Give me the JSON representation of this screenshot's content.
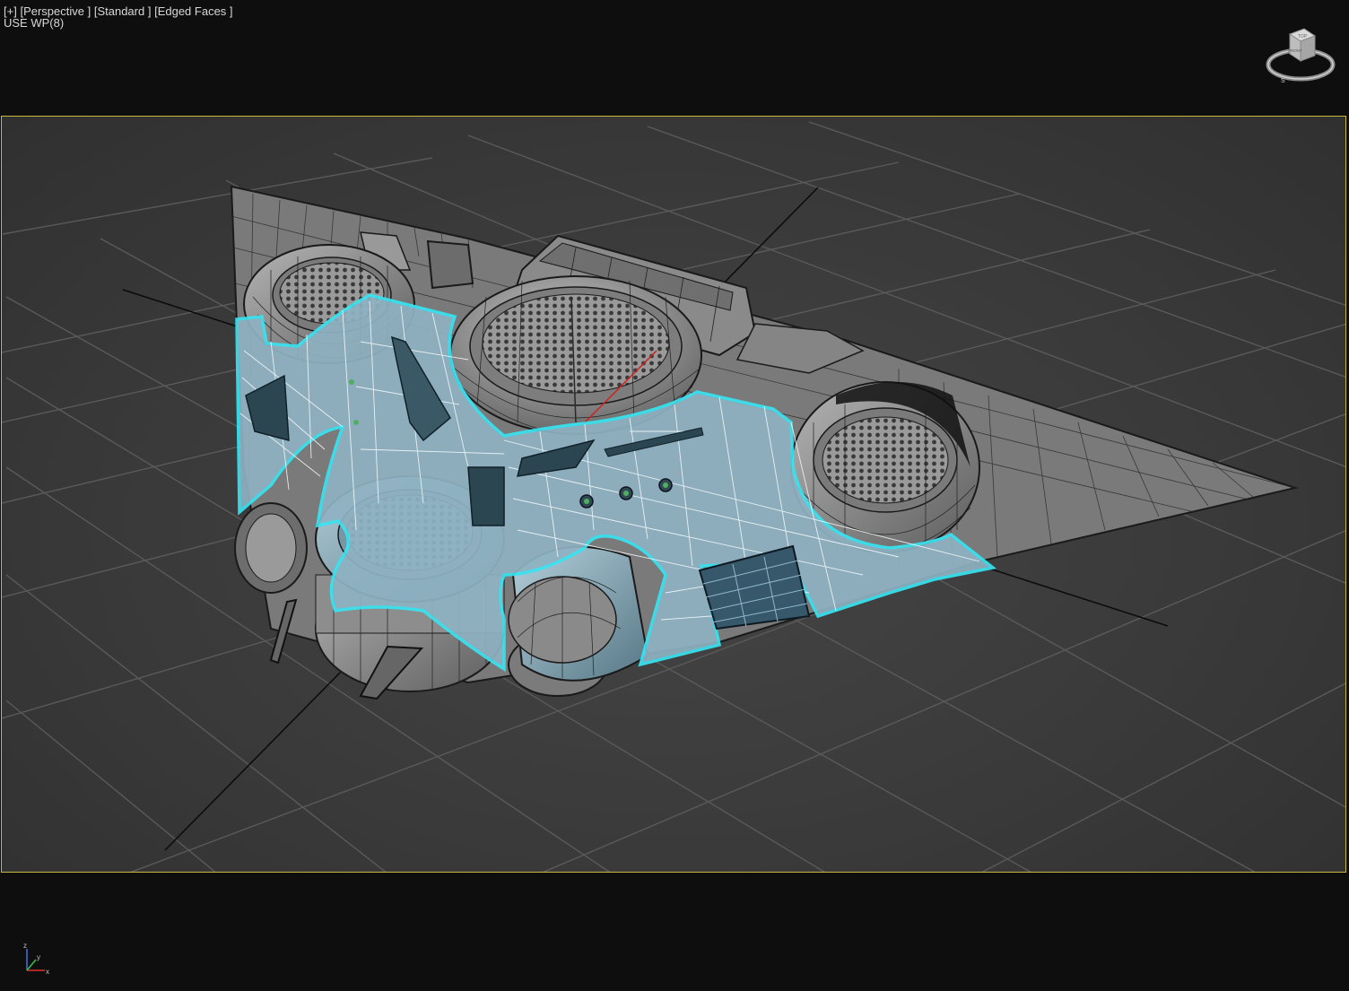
{
  "viewport": {
    "labels": [
      "[+]",
      "[Perspective ]",
      "[Standard ]",
      "[Edged Faces ]"
    ],
    "workplane_label": "USE WP(8)"
  },
  "viewcube": {
    "top_label": "TOP",
    "front_label": "FRONT",
    "compass_label": "S"
  },
  "axis_tripod": {
    "x": "x",
    "y": "y",
    "z": "z"
  },
  "colors": {
    "background": "#0e0e0e",
    "safe_frame_border": "#c8b840",
    "grid_line": "#555555",
    "selection_outline": "#38e4f2",
    "selected_fill": "#8fb2c2",
    "mesh_fill": "#8c8c8c",
    "wire": "#1a1a1a"
  },
  "icons": [
    "viewcube-icon",
    "axis-tripod-icon"
  ]
}
